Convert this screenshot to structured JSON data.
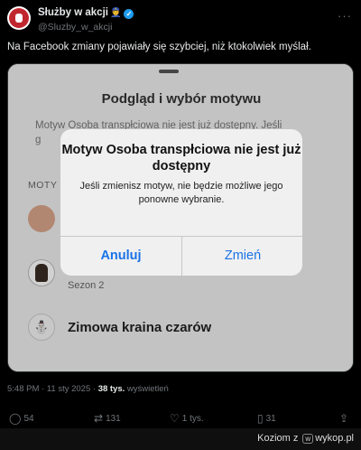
{
  "header": {
    "name": "Służby w akcji",
    "name_emoji": "👮",
    "handle": "@Sluzby_w_akcji",
    "more": "···"
  },
  "tweet": {
    "text": "Na Facebook zmiany pojawiały się szybciej, niż ktokolwiek myślał."
  },
  "screenshot": {
    "sheet_title": "Podgląd i wybór motywu",
    "sheet_desc_line1": "Motyw Osoba transpłciowa nie jest już dostępny. Jeśli",
    "sheet_desc_line2": "g",
    "section_label": "MOTY",
    "theme_sezon": "Sezon 2",
    "theme_winter": "Zimowa kraina czarów",
    "theme_winter_icon": "⛄",
    "alert": {
      "title": "Motyw Osoba transpłciowa nie jest już dostępny",
      "message": "Jeśli zmienisz motyw, nie będzie możliwe jego ponowne wybranie.",
      "cancel_label": "Anuluj",
      "confirm_label": "Zmień"
    }
  },
  "meta": {
    "time": "5:48 PM · 11 sty 2025 · ",
    "views": "38 tys.",
    "views_suffix": " wyświetleń"
  },
  "actions": {
    "replies": "54",
    "reposts": "131",
    "likes": "1 tys.",
    "bookmarks": "31"
  },
  "footer": {
    "prefix": "Koziom z",
    "site": "wykop.pl",
    "logo_text": "w"
  },
  "colors": {
    "accent": "#1a73e8",
    "verified": "#1d9bf0",
    "background": "#000000"
  }
}
